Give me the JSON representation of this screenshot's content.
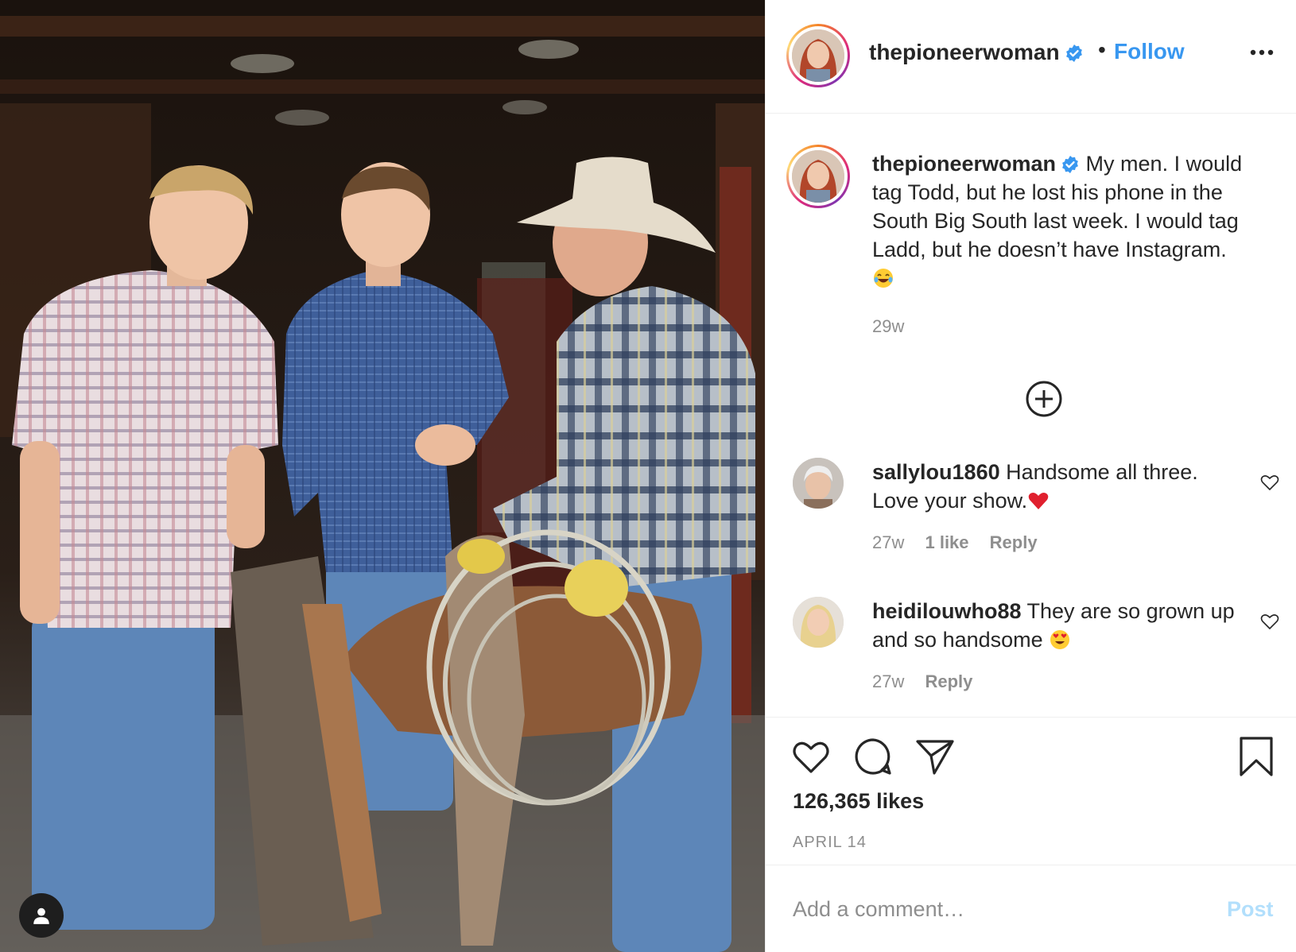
{
  "post": {
    "username": "thepioneerwoman",
    "follow_label": "Follow",
    "separator": "•",
    "more_icon": "more-horizontal-icon",
    "verified_icon": "verified-badge-icon"
  },
  "caption": {
    "username": "thepioneerwoman",
    "text": "My men. I would tag Todd, but he lost his phone in the South Big South last week. I would tag Ladd, but he doesn’t have Instagram.",
    "emoji": "face-with-tears-of-joy",
    "time": "29w"
  },
  "load_more_icon": "plus-circle-icon",
  "comments": [
    {
      "username": "sallylou1860",
      "text": "Handsome all three. Love your show.",
      "emoji": "red-heart",
      "time": "27w",
      "likes": "1 like",
      "reply": "Reply"
    },
    {
      "username": "heidilouwho88",
      "text": "They are so grown up and so handsome",
      "emoji": "heart-eyes",
      "time": "27w",
      "reply": "Reply"
    }
  ],
  "actions": {
    "like_icon": "heart-icon",
    "comment_icon": "comment-bubble-icon",
    "share_icon": "paper-plane-icon",
    "save_icon": "bookmark-icon"
  },
  "likes": "126,365 likes",
  "date": "APRIL 14",
  "add_comment": {
    "placeholder": "Add a comment…",
    "post_label": "Post"
  },
  "colors": {
    "link_blue": "#3897f0",
    "post_disabled": "#b2dffc",
    "secondary_text": "#8e8e8e",
    "verified_blue": "#3897f0"
  }
}
